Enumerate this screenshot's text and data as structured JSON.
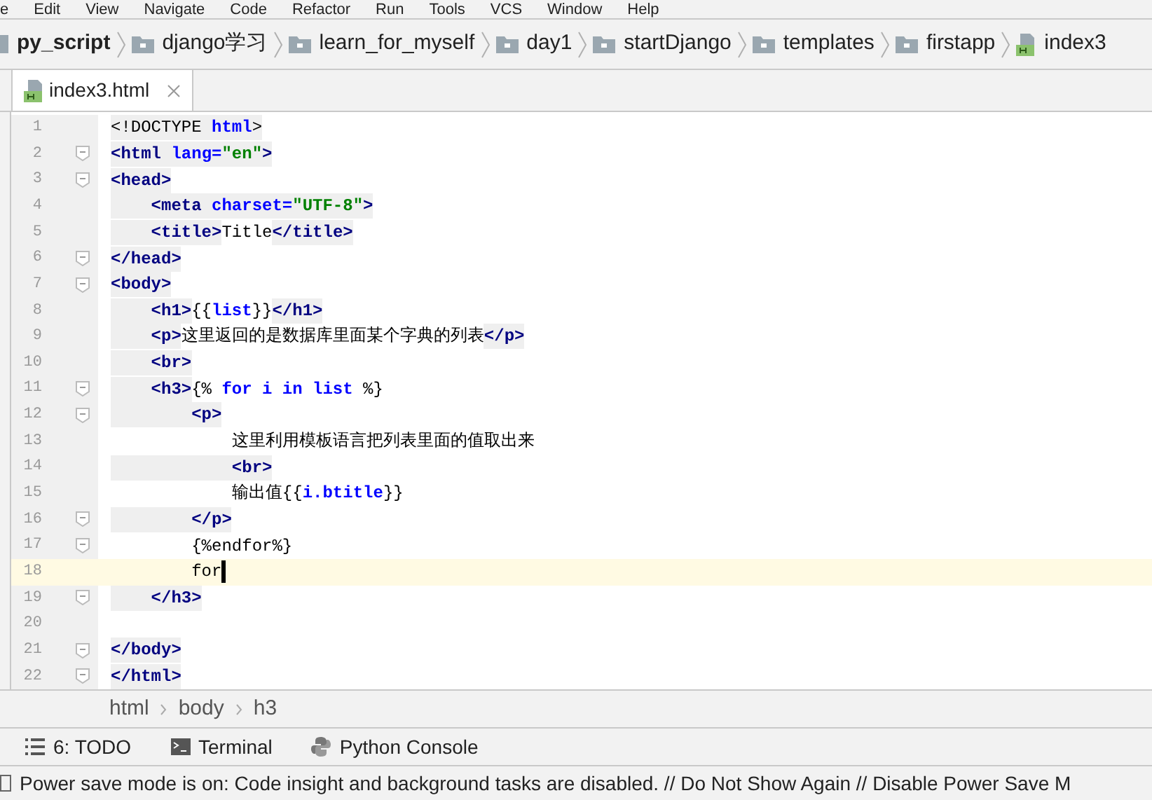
{
  "menu": [
    "e",
    "Edit",
    "View",
    "Navigate",
    "Code",
    "Refactor",
    "Run",
    "Tools",
    "VCS",
    "Window",
    "Help"
  ],
  "navigation": [
    {
      "label": "py_script",
      "kind": "project"
    },
    {
      "label": "django学习",
      "kind": "folder"
    },
    {
      "label": "learn_for_myself",
      "kind": "folder"
    },
    {
      "label": "day1",
      "kind": "folder"
    },
    {
      "label": "startDjango",
      "kind": "folder"
    },
    {
      "label": "templates",
      "kind": "folder"
    },
    {
      "label": "firstapp",
      "kind": "folder"
    },
    {
      "label": "index3",
      "kind": "html"
    }
  ],
  "tabs": [
    {
      "label": "index3.html",
      "selected": true
    }
  ],
  "editor": {
    "lines": [
      {
        "number": "1",
        "fold": false,
        "current": false,
        "tokens": [
          {
            "kind": "punct",
            "text": "<!DOCTYPE "
          },
          {
            "kind": "attr",
            "text": "html"
          },
          {
            "kind": "punct",
            "text": ">"
          }
        ]
      },
      {
        "number": "2",
        "fold": true,
        "current": false,
        "tokens": [
          {
            "kind": "tag",
            "text": "<html "
          },
          {
            "kind": "attr",
            "text": "lang="
          },
          {
            "kind": "value",
            "text": "\"en\""
          },
          {
            "kind": "tag",
            "text": ">"
          }
        ]
      },
      {
        "number": "3",
        "fold": true,
        "current": false,
        "tokens": [
          {
            "kind": "tag",
            "text": "<head>"
          }
        ]
      },
      {
        "number": "4",
        "fold": false,
        "current": false,
        "tokens": [
          {
            "kind": "tag",
            "text": "    <meta "
          },
          {
            "kind": "attr",
            "text": "charset="
          },
          {
            "kind": "value",
            "text": "\"UTF-8\""
          },
          {
            "kind": "tag",
            "text": ">"
          }
        ]
      },
      {
        "number": "5",
        "fold": false,
        "current": false,
        "tokens": [
          {
            "kind": "tag",
            "text": "    <title>"
          },
          {
            "kind": "text",
            "text": "Title"
          },
          {
            "kind": "tag",
            "text": "</title>"
          }
        ]
      },
      {
        "number": "6",
        "fold": true,
        "current": false,
        "tokens": [
          {
            "kind": "tag",
            "text": "</head>"
          }
        ]
      },
      {
        "number": "7",
        "fold": true,
        "current": false,
        "tokens": [
          {
            "kind": "tag",
            "text": "<body>"
          }
        ]
      },
      {
        "number": "8",
        "fold": false,
        "current": false,
        "tokens": [
          {
            "kind": "tag",
            "text": "    <h1>"
          },
          {
            "kind": "text",
            "text": "{{"
          },
          {
            "kind": "var",
            "text": "list"
          },
          {
            "kind": "text",
            "text": "}}"
          },
          {
            "kind": "tag",
            "text": "</h1>"
          }
        ]
      },
      {
        "number": "9",
        "fold": false,
        "current": false,
        "tokens": [
          {
            "kind": "tag",
            "text": "    <p>"
          },
          {
            "kind": "text",
            "text": "这里返回的是数据库里面某个字典的列表"
          },
          {
            "kind": "tag",
            "text": "</p>"
          }
        ]
      },
      {
        "number": "10",
        "fold": false,
        "current": false,
        "tokens": [
          {
            "kind": "tag",
            "text": "    <br>"
          }
        ]
      },
      {
        "number": "11",
        "fold": true,
        "current": false,
        "tokens": [
          {
            "kind": "tag",
            "text": "    <h3>"
          },
          {
            "kind": "text",
            "text": "{% "
          },
          {
            "kind": "var",
            "text": "for i in list"
          },
          {
            "kind": "text",
            "text": " %}"
          }
        ]
      },
      {
        "number": "12",
        "fold": true,
        "current": false,
        "tokens": [
          {
            "kind": "tag",
            "text": "        <p>"
          }
        ]
      },
      {
        "number": "13",
        "fold": false,
        "current": false,
        "tokens": [
          {
            "kind": "text",
            "text": "            这里利用模板语言把列表里面的值取出来"
          }
        ]
      },
      {
        "number": "14",
        "fold": false,
        "current": false,
        "tokens": [
          {
            "kind": "tag",
            "text": "            <br>"
          }
        ]
      },
      {
        "number": "15",
        "fold": false,
        "current": false,
        "tokens": [
          {
            "kind": "text",
            "text": "            输出值{{"
          },
          {
            "kind": "var",
            "text": "i.btitle"
          },
          {
            "kind": "text",
            "text": "}}"
          }
        ]
      },
      {
        "number": "16",
        "fold": true,
        "current": false,
        "tokens": [
          {
            "kind": "tag",
            "text": "        </p>"
          }
        ]
      },
      {
        "number": "17",
        "fold": true,
        "current": false,
        "tokens": [
          {
            "kind": "text",
            "text": "        {%endfor%}"
          }
        ]
      },
      {
        "number": "18",
        "fold": false,
        "current": true,
        "tokens": [
          {
            "kind": "text",
            "text": "        for"
          }
        ]
      },
      {
        "number": "19",
        "fold": true,
        "current": false,
        "tokens": [
          {
            "kind": "tag",
            "text": "    </h3>"
          }
        ]
      },
      {
        "number": "20",
        "fold": false,
        "current": false
      },
      {
        "number": "21",
        "fold": true,
        "current": false,
        "tokens": [
          {
            "kind": "tag",
            "text": "</body>"
          }
        ]
      },
      {
        "number": "22",
        "fold": true,
        "current": false,
        "tokens": [
          {
            "kind": "tag",
            "text": "</html>"
          }
        ]
      }
    ]
  },
  "breadcrumb": [
    "html",
    "body",
    "h3"
  ],
  "tool_windows": [
    {
      "label": "6: TODO",
      "kind": "todo"
    },
    {
      "label": "Terminal",
      "kind": "terminal"
    },
    {
      "label": "Python Console",
      "kind": "python"
    }
  ],
  "status_bar": "Power save mode is on: Code insight and background tasks are disabled. // Do Not Show Again // Disable Power Save M"
}
